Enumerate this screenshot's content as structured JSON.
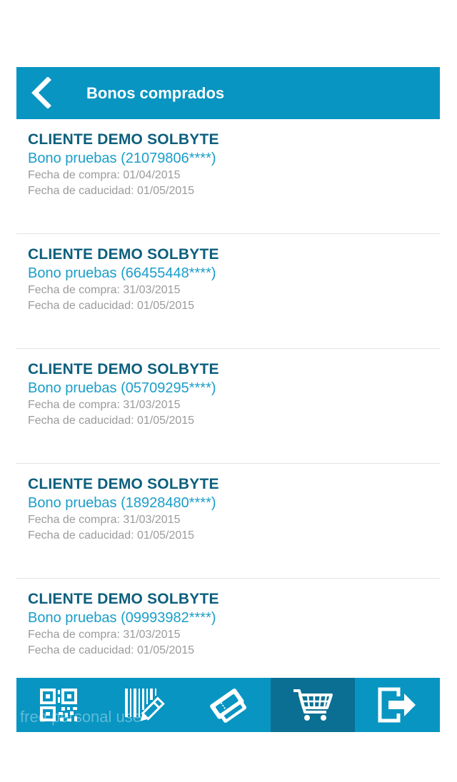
{
  "header": {
    "title": "Bonos comprados",
    "back_icon": "chevron-left-icon"
  },
  "vouchers": [
    {
      "client": "CLIENTE DEMO SOLBYTE",
      "bono": "Bono pruebas (21079806****)",
      "purchase": "Fecha de compra: 01/04/2015",
      "expiry": "Fecha de caducidad: 01/05/2015"
    },
    {
      "client": "CLIENTE DEMO SOLBYTE",
      "bono": "Bono pruebas (66455448****)",
      "purchase": "Fecha de compra: 31/03/2015",
      "expiry": "Fecha de caducidad: 01/05/2015"
    },
    {
      "client": "CLIENTE DEMO SOLBYTE",
      "bono": "Bono pruebas (05709295****)",
      "purchase": "Fecha de compra: 31/03/2015",
      "expiry": "Fecha de caducidad: 01/05/2015"
    },
    {
      "client": "CLIENTE DEMO SOLBYTE",
      "bono": "Bono pruebas (18928480****)",
      "purchase": "Fecha de compra: 31/03/2015",
      "expiry": "Fecha de caducidad: 01/05/2015"
    },
    {
      "client": "CLIENTE DEMO SOLBYTE",
      "bono": "Bono pruebas (09993982****)",
      "purchase": "Fecha de compra: 31/03/2015",
      "expiry": "Fecha de caducidad: 01/05/2015"
    }
  ],
  "tabbar": {
    "tabs": [
      {
        "icon": "qr-code-icon",
        "active": false
      },
      {
        "icon": "barcode-pencil-icon",
        "active": false
      },
      {
        "icon": "tickets-icon",
        "active": false
      },
      {
        "icon": "shopping-cart-icon",
        "active": true
      },
      {
        "icon": "logout-icon",
        "active": false
      }
    ],
    "watermark": "free personal use"
  },
  "colors": {
    "primary": "#0895c2",
    "primary_dark": "#0a6f93",
    "client_text": "#0c5f7d",
    "bono_text": "#1a9ec9",
    "meta_text": "#9b9b9b"
  }
}
